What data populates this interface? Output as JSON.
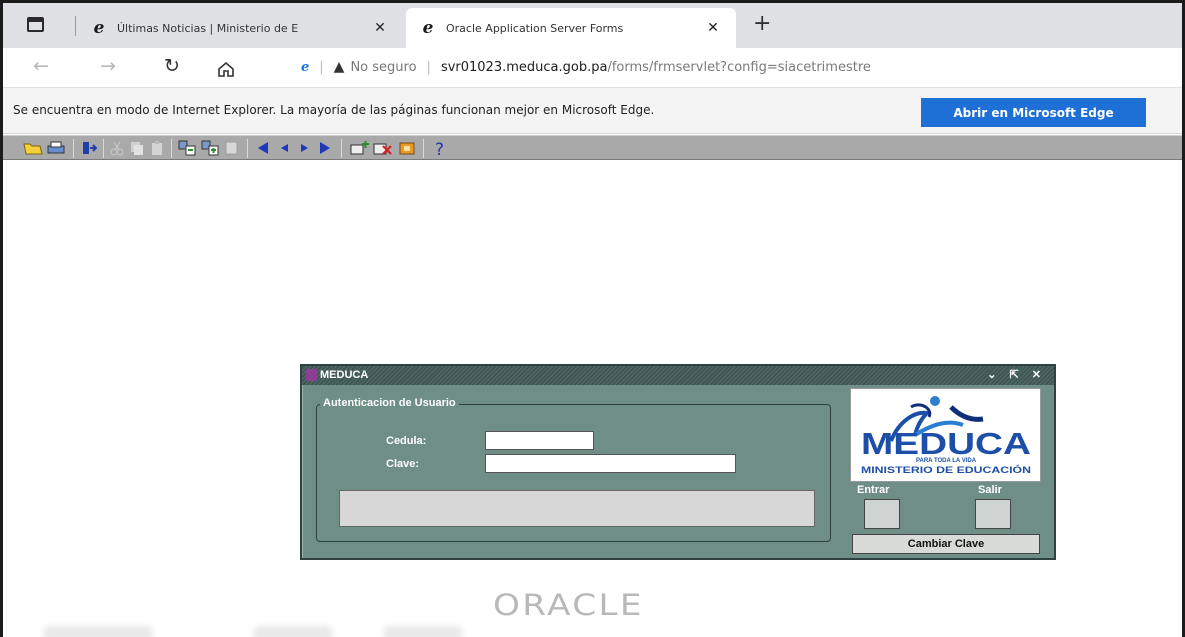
{
  "browser": {
    "tabs": [
      {
        "title": "Últimas Noticias | Ministerio de E",
        "icon": "ie-icon"
      },
      {
        "title": "Oracle Application Server Forms",
        "icon": "ie-icon",
        "active": true
      }
    ],
    "close_glyph": "✕",
    "new_tab_glyph": "+",
    "address": {
      "security_label": "No seguro",
      "host": "svr01023.meduca.gob.pa",
      "path": "/forms/frmservlet?config=siacetrimestre"
    },
    "infobar": {
      "text": "Se encuentra en modo de Internet Explorer. La mayoría de las páginas funcionan mejor en Microsoft Edge.",
      "button": "Abrir en Microsoft Edge"
    }
  },
  "dialog": {
    "title": "MEDUCA",
    "window_buttons": "⌄ ⇱ ✕",
    "group_title": "Autenticacion de Usuario",
    "cedula_label": "Cedula:",
    "cedula_value": "",
    "clave_label": "Clave:",
    "clave_value": "",
    "logo": {
      "name": "MEDUCA",
      "tagline": "PARA TODA LA VIDA",
      "ministry": "MINISTERIO DE EDUCACIÓN"
    },
    "entrar_label": "Entrar",
    "salir_label": "Salir",
    "cambiar_label": "Cambiar Clave"
  },
  "footer": {
    "brand": "ORACLE"
  },
  "colors": {
    "dialog_bg": "#6f8f86",
    "edge_button": "#1f70d6",
    "toolbar": "#a9a9a9"
  }
}
